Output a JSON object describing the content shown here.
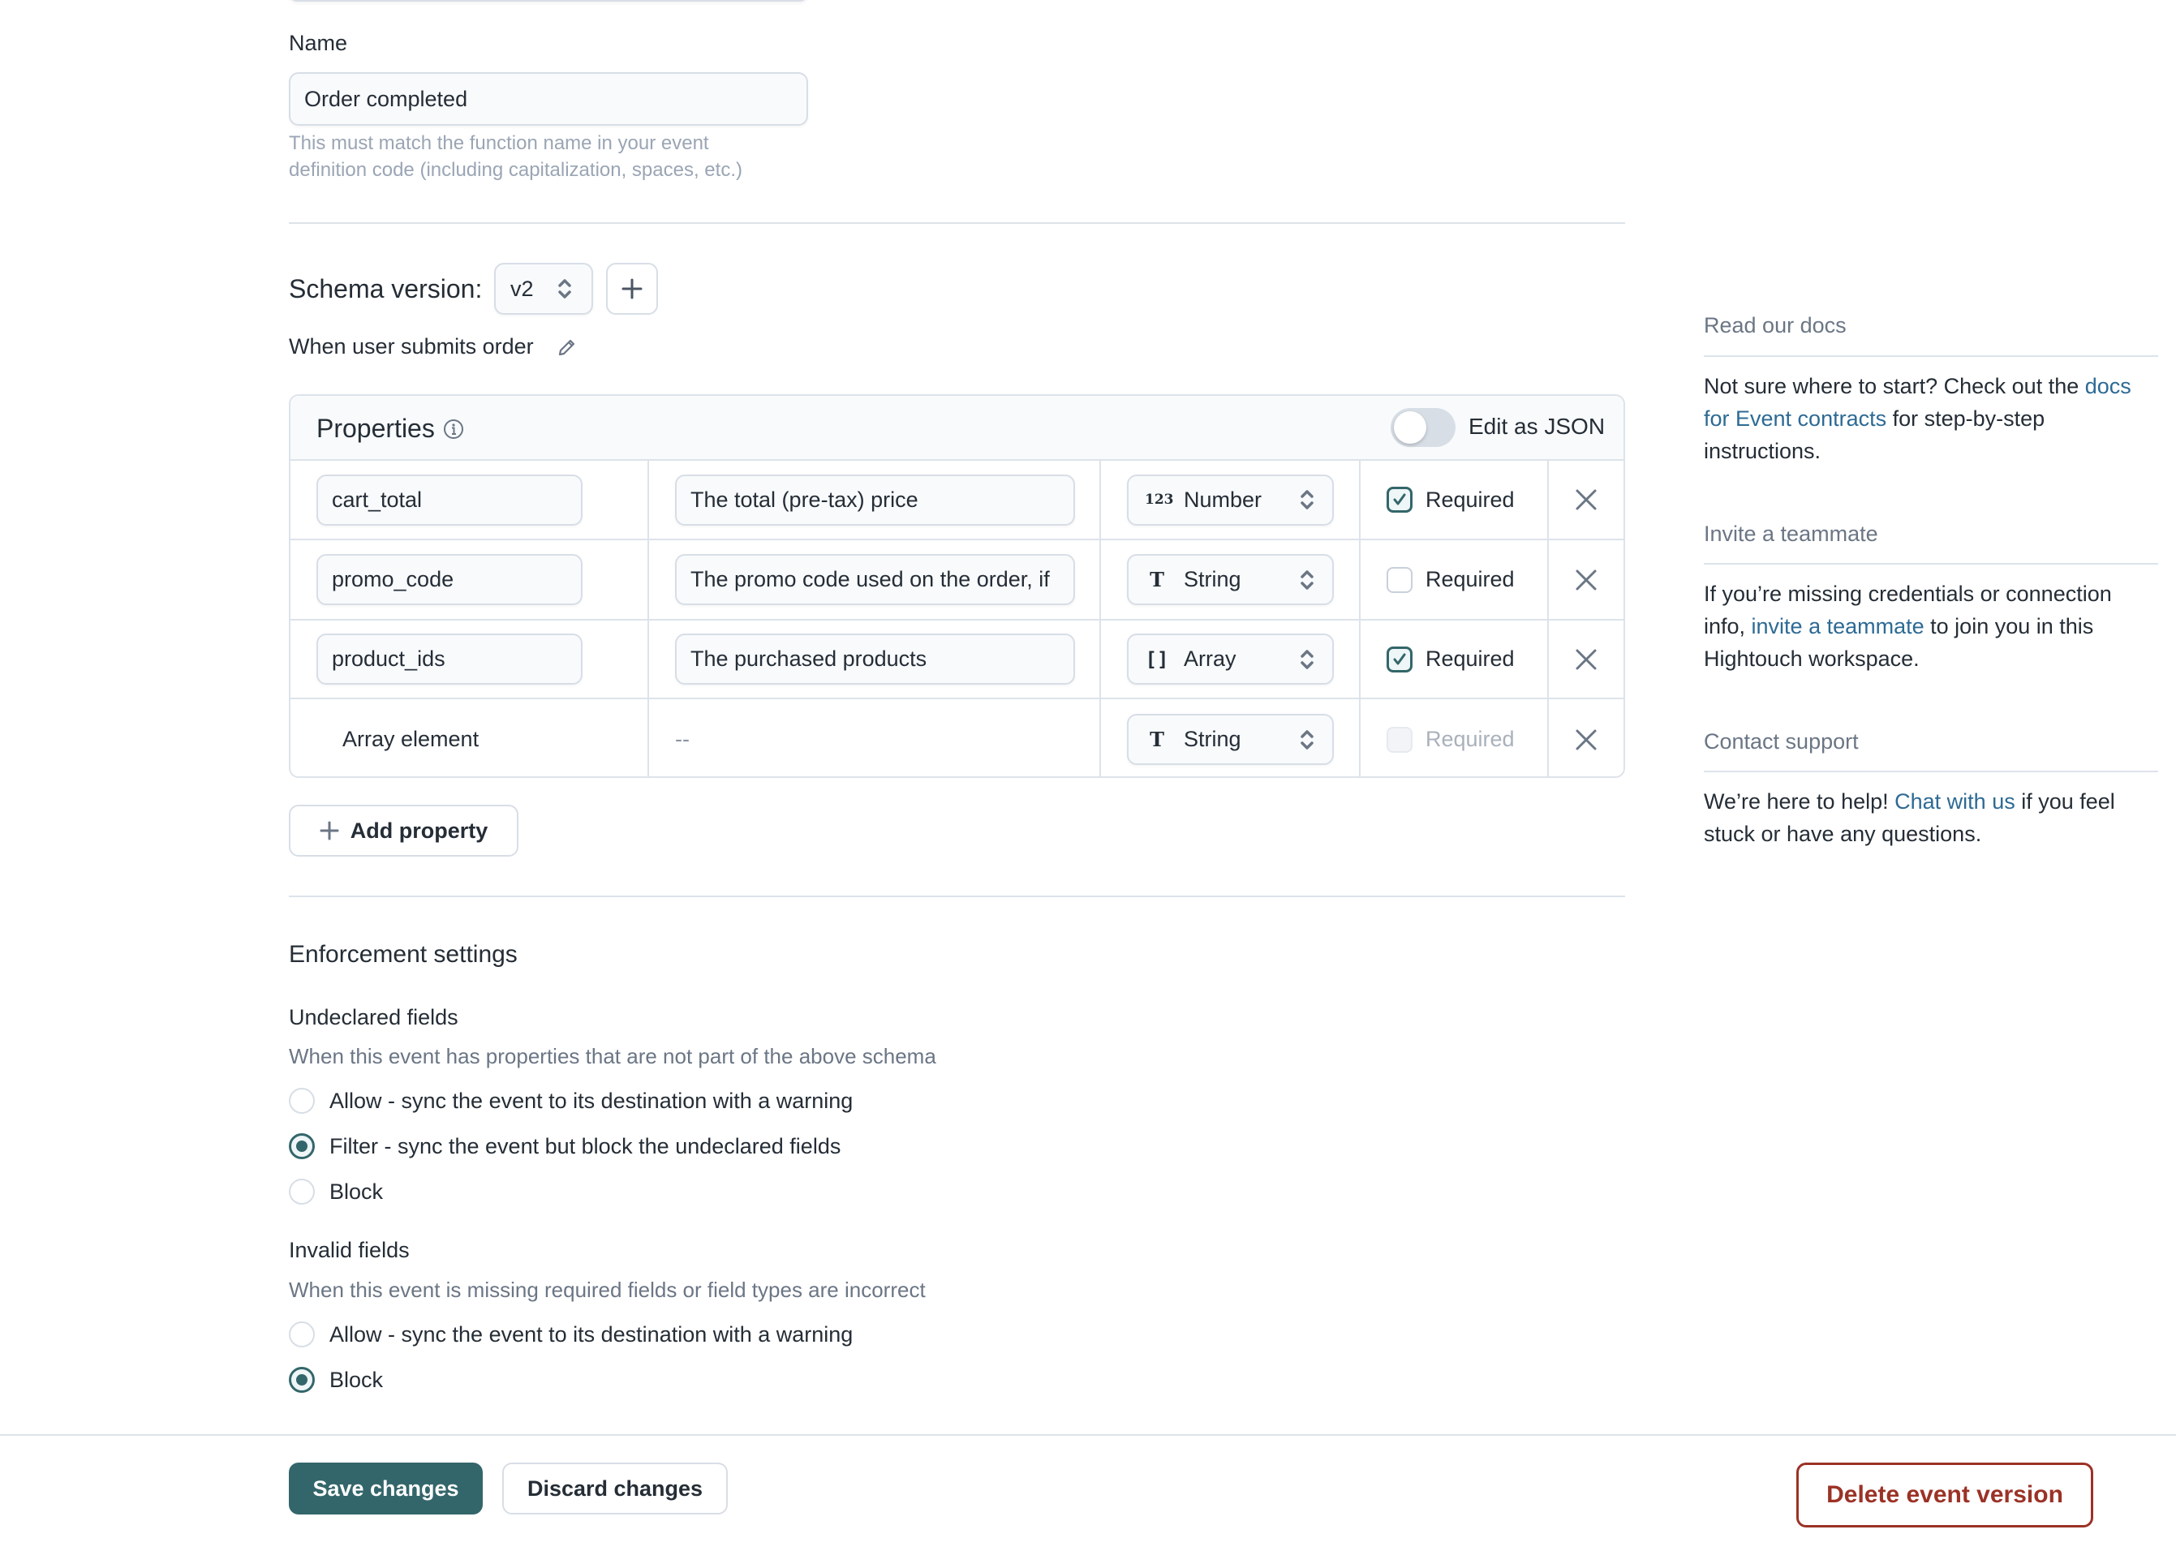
{
  "name_field": {
    "label": "Name",
    "value": "Order completed",
    "help": "This must match the function name in your event definition code (including capitalization, spaces, etc.)"
  },
  "schema": {
    "label": "Schema version:",
    "version": "v2",
    "description": "When user submits order"
  },
  "properties": {
    "title": "Properties",
    "edit_as_json_label": "Edit as JSON",
    "edit_as_json_enabled": false,
    "rows": [
      {
        "name": "cart_total",
        "description": "The total (pre-tax) price",
        "type": "Number",
        "type_icon": "123",
        "required_label": "Required",
        "required": true
      },
      {
        "name": "promo_code",
        "description": "The promo code used on the order, if",
        "type": "String",
        "type_icon": "T",
        "required_label": "Required",
        "required": false
      },
      {
        "name": "product_ids",
        "description": "The purchased products",
        "type": "Array",
        "type_icon": "[]",
        "required_label": "Required",
        "required": true
      },
      {
        "name": "Array element",
        "description": "--",
        "type": "String",
        "type_icon": "T",
        "required_label": "Required",
        "required": false,
        "required_disabled": true
      }
    ],
    "add_label": "Add property"
  },
  "enforcement": {
    "title": "Enforcement settings",
    "undeclared": {
      "title": "Undeclared fields",
      "description": "When this event has properties that are not part of the above schema",
      "options": [
        {
          "label": "Allow - sync the event to its destination with a warning",
          "selected": false
        },
        {
          "label": "Filter - sync the event but block the undeclared fields",
          "selected": true
        },
        {
          "label": "Block",
          "selected": false
        }
      ]
    },
    "invalid": {
      "title": "Invalid fields",
      "description": "When this event is missing required fields or field types are incorrect",
      "options": [
        {
          "label": "Allow - sync the event to its destination with a warning",
          "selected": false
        },
        {
          "label": "Block",
          "selected": true
        }
      ]
    }
  },
  "sidebar": {
    "docs": {
      "title": "Read our docs",
      "text_before": "Not sure where to start? Check out the ",
      "link": "docs for Event contracts",
      "text_after": " for step-by-step instructions."
    },
    "invite": {
      "title": "Invite a teammate",
      "text_before": "If you’re missing credentials or connection info, ",
      "link": "invite a teammate",
      "text_after": " to join you in this Hightouch workspace."
    },
    "support": {
      "title": "Contact support",
      "text_before": "We’re here to help! ",
      "link": "Chat with us",
      "text_after": " if you feel stuck or have any questions."
    }
  },
  "footer": {
    "save_label": "Save changes",
    "discard_label": "Discard changes",
    "delete_label": "Delete event version"
  },
  "colors": {
    "primary": "#33666a",
    "danger": "#9b3226",
    "link": "#2d6a94"
  }
}
